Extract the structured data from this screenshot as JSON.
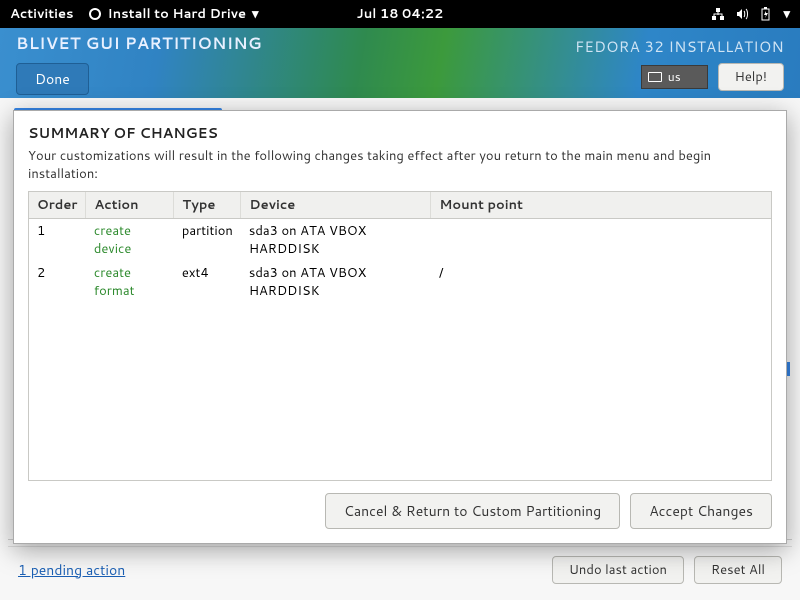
{
  "topbar": {
    "activities": "Activities",
    "app_name": "Install to Hard Drive",
    "datetime": "Jul 18  04:22"
  },
  "header": {
    "title": "BLIVET GUI PARTITIONING",
    "distro": "FEDORA 32 INSTALLATION",
    "keyboard": "us",
    "help": "Help!",
    "done": "Done"
  },
  "footer": {
    "pending": "1 pending action",
    "undo": "Undo last action",
    "reset": "Reset All"
  },
  "dialog": {
    "title": "SUMMARY OF CHANGES",
    "subtitle": "Your customizations will result in the following changes taking effect after you return to the main menu and begin installation:",
    "columns": {
      "order": "Order",
      "action": "Action",
      "type": "Type",
      "device": "Device",
      "mount": "Mount point"
    },
    "rows": [
      {
        "order": "1",
        "action": "create device",
        "type": "partition",
        "device": "sda3 on ATA VBOX HARDDISK",
        "mount": ""
      },
      {
        "order": "2",
        "action": "create format",
        "type": "ext4",
        "device": "sda3 on ATA VBOX HARDDISK",
        "mount": "/"
      }
    ],
    "cancel": "Cancel & Return to Custom Partitioning",
    "accept": "Accept Changes"
  }
}
